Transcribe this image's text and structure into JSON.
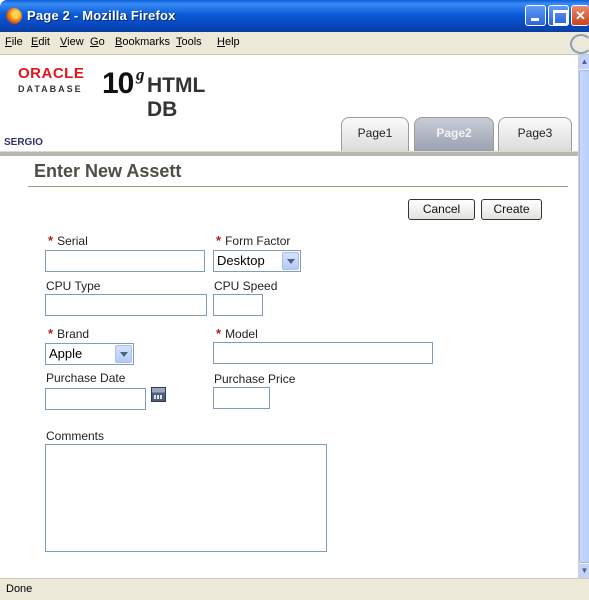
{
  "window": {
    "title": "Page 2 - Mozilla Firefox"
  },
  "menu": {
    "items": [
      {
        "accel": "F",
        "rest": "ile"
      },
      {
        "accel": "E",
        "rest": "dit"
      },
      {
        "accel": "V",
        "rest": "iew"
      },
      {
        "accel": "G",
        "rest": "o"
      },
      {
        "accel": "B",
        "rest": "ookmarks"
      },
      {
        "accel": "T",
        "rest": "ools"
      },
      {
        "accel": "H",
        "rest": "elp"
      }
    ]
  },
  "logo": {
    "oracle": "ORACLE",
    "database": "DATABASE",
    "version": "10",
    "superscript": "g",
    "product": "HTML DB"
  },
  "user": "SERGIO",
  "tabs": [
    {
      "label": "Page1",
      "selected": false
    },
    {
      "label": "Page2",
      "selected": true
    },
    {
      "label": "Page3",
      "selected": false
    }
  ],
  "page": {
    "title": "Enter New Assett"
  },
  "buttons": {
    "cancel": "Cancel",
    "create": "Create"
  },
  "form": {
    "required_marker": "*",
    "serial_label": "Serial",
    "serial_value": "",
    "form_factor_label": "Form Factor",
    "form_factor_value": "Desktop",
    "cpu_type_label": "CPU Type",
    "cpu_type_value": "",
    "cpu_speed_label": "CPU Speed",
    "cpu_speed_value": "",
    "brand_label": "Brand",
    "brand_value": "Apple",
    "model_label": "Model",
    "model_value": "",
    "purchase_date_label": "Purchase Date",
    "purchase_date_value": "",
    "purchase_price_label": "Purchase Price",
    "purchase_price_value": "",
    "comments_label": "Comments",
    "comments_value": ""
  },
  "status": {
    "text": "Done"
  }
}
